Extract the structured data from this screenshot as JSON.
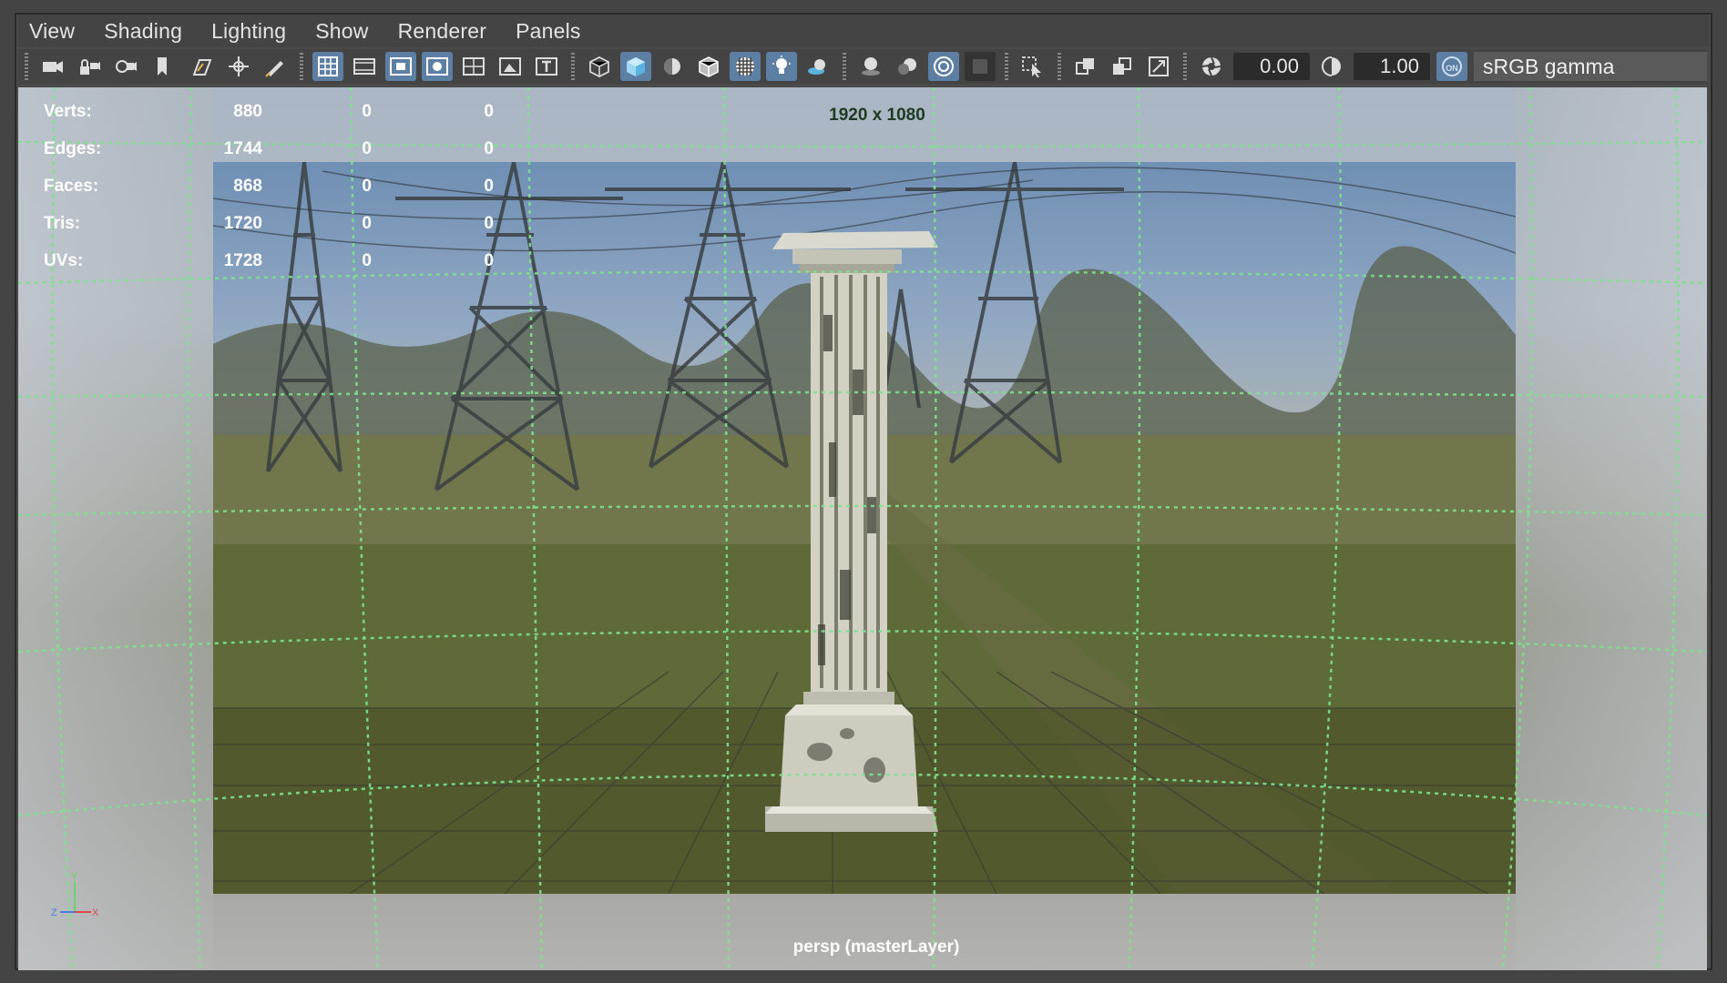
{
  "menubar": {
    "items": [
      "View",
      "Shading",
      "Lighting",
      "Show",
      "Renderer",
      "Panels"
    ]
  },
  "toolbar": {
    "icons": {
      "camera": "camera-icon",
      "lock_camera": "lock-camera-icon",
      "camera_attributes": "camera-attributes-icon",
      "bookmark": "bookmark-icon",
      "image_plane": "image-plane-icon",
      "pan_zoom": "pan-zoom-icon",
      "grease_pencil": "grease-pencil-icon",
      "grid": "grid-icon",
      "film_gate": "film-gate-icon",
      "resolution_gate": "resolution-gate-icon",
      "gate_mask": "gate-mask-icon",
      "field_chart": "field-chart-icon",
      "safe_action": "safe-action-icon",
      "safe_title": "safe-title-icon",
      "wireframe": "wireframe-icon",
      "smooth_shade": "smooth-shade-icon",
      "default_material": "default-material-icon",
      "wireframe_on_shaded": "wireframe-on-shaded-icon",
      "textured": "textured-icon",
      "use_lights": "use-lights-icon",
      "shadows": "shadows-icon",
      "screen_space_ao": "screen-space-ao-icon",
      "motion_blur": "motion-blur-icon",
      "antialiasing": "antialiasing-icon",
      "depth_of_field": "depth-of-field-icon",
      "isolate_select": "isolate-select-icon",
      "xray": "xray-icon",
      "xray_joints": "xray-joints-icon",
      "xray_active": "xray-active-icon",
      "exposure": "exposure-icon",
      "gamma": "gamma-icon",
      "color_management": "color-management-icon"
    },
    "exposure_value": "0.00",
    "gamma_value": "1.00",
    "cm_toggle_label": "ON",
    "color_space": "sRGB gamma"
  },
  "hud": {
    "stats": [
      {
        "label": "Verts:",
        "v1": "880",
        "v2": "0",
        "v3": "0"
      },
      {
        "label": "Edges:",
        "v1": "1744",
        "v2": "0",
        "v3": "0"
      },
      {
        "label": "Faces:",
        "v1": "868",
        "v2": "0",
        "v3": "0"
      },
      {
        "label": "Tris:",
        "v1": "1720",
        "v2": "0",
        "v3": "0"
      },
      {
        "label": "UVs:",
        "v1": "1728",
        "v2": "0",
        "v3": "0"
      }
    ],
    "resolution": "1920 x 1080",
    "camera_label": "persp (masterLayer)",
    "axis": {
      "y": "Y",
      "z": "Z",
      "x": "X"
    }
  },
  "colors": {
    "accent": "#5d7fa3",
    "grid_line": "#7de38a",
    "panel_bg": "#444444"
  }
}
